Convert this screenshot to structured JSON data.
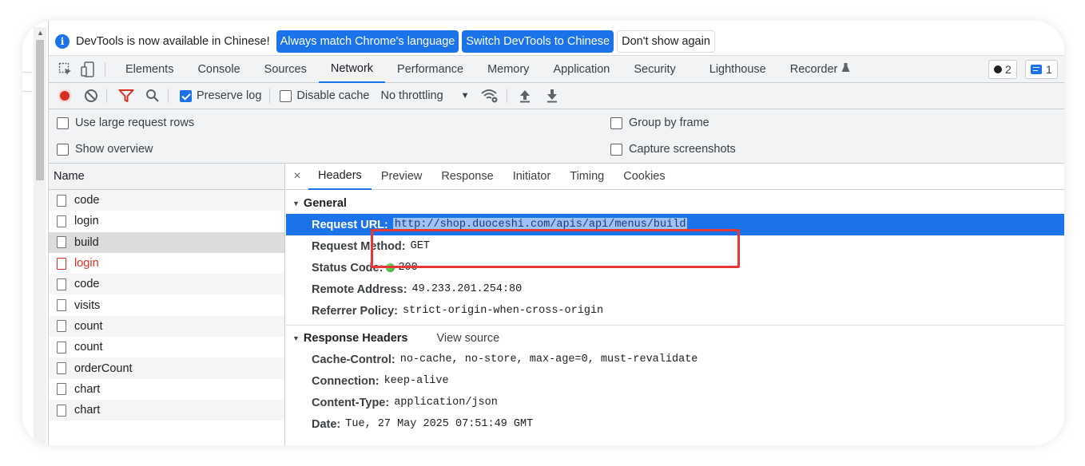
{
  "infobar": {
    "message": "DevTools is now available in Chinese!",
    "btn_match": "Always match Chrome's language",
    "btn_switch": "Switch DevTools to Chinese",
    "btn_dismiss": "Don't show again"
  },
  "tabs": {
    "items": [
      "Elements",
      "Console",
      "Sources",
      "Network",
      "Performance",
      "Memory",
      "Application",
      "Security",
      "Lighthouse",
      "Recorder"
    ],
    "active": "Network",
    "issues_count": "2",
    "messages_count": "1"
  },
  "toolbar": {
    "preserve_log": "Preserve log",
    "disable_cache": "Disable cache",
    "throttling": "No throttling"
  },
  "settings": {
    "large_rows": "Use large request rows",
    "show_overview": "Show overview",
    "group_by_frame": "Group by frame",
    "capture_screenshots": "Capture screenshots"
  },
  "requests": {
    "header": "Name",
    "rows": [
      {
        "name": "code",
        "status": "ok"
      },
      {
        "name": "login",
        "status": "ok"
      },
      {
        "name": "build",
        "status": "selected"
      },
      {
        "name": "login",
        "status": "error"
      },
      {
        "name": "code",
        "status": "ok"
      },
      {
        "name": "visits",
        "status": "ok"
      },
      {
        "name": "count",
        "status": "ok"
      },
      {
        "name": "count",
        "status": "ok"
      },
      {
        "name": "orderCount",
        "status": "ok"
      },
      {
        "name": "chart",
        "status": "ok"
      },
      {
        "name": "chart",
        "status": "ok"
      }
    ]
  },
  "details": {
    "close": "×",
    "tabs": [
      "Headers",
      "Preview",
      "Response",
      "Initiator",
      "Timing",
      "Cookies"
    ],
    "active_tab": "Headers",
    "general_title": "General",
    "general": [
      {
        "key": "Request URL:",
        "value": "http://shop.duoceshi.com/apis/api/menus/build"
      },
      {
        "key": "Request Method:",
        "value": "GET"
      },
      {
        "key": "Status Code:",
        "value": "200"
      },
      {
        "key": "Remote Address:",
        "value": "49.233.201.254:80"
      },
      {
        "key": "Referrer Policy:",
        "value": "strict-origin-when-cross-origin"
      }
    ],
    "response_title": "Response Headers",
    "view_source": "View source",
    "response": [
      {
        "key": "Cache-Control:",
        "value": "no-cache, no-store, max-age=0, must-revalidate"
      },
      {
        "key": "Connection:",
        "value": "keep-alive"
      },
      {
        "key": "Content-Type:",
        "value": "application/json"
      },
      {
        "key": "Date:",
        "value": "Tue, 27 May 2025 07:51:49 GMT"
      }
    ]
  },
  "colors": {
    "accent": "#1a73e8",
    "error": "#d93025",
    "annotation": "#e53935",
    "status_ok": "#1ea21e"
  }
}
